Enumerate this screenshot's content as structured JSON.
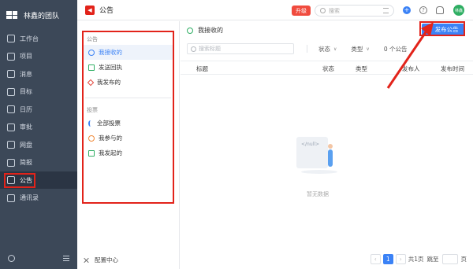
{
  "sidebar": {
    "team_name": "林鑫的团队",
    "items": [
      {
        "label": "工作台",
        "icon": "desktop-icon"
      },
      {
        "label": "项目",
        "icon": "project-icon"
      },
      {
        "label": "消息",
        "icon": "message-icon"
      },
      {
        "label": "目标",
        "icon": "target-icon"
      },
      {
        "label": "日历",
        "icon": "calendar-icon"
      },
      {
        "label": "审批",
        "icon": "approval-icon"
      },
      {
        "label": "网盘",
        "icon": "cloud-disk-icon"
      },
      {
        "label": "简报",
        "icon": "report-icon"
      },
      {
        "label": "公告",
        "icon": "announcement-icon"
      },
      {
        "label": "通讯录",
        "icon": "contacts-icon"
      }
    ]
  },
  "topbar": {
    "title": "公告",
    "upgrade_label": "升级",
    "search_placeholder": "搜索",
    "avatar_text": "林鑫"
  },
  "announce_menu": {
    "group1_title": "公告",
    "group1_items": [
      "我接收的",
      "发送回执",
      "我发布的"
    ],
    "group2_title": "投票",
    "group2_items": [
      "全部投票",
      "我参与的",
      "我发起的"
    ],
    "config_label": "配置中心"
  },
  "main": {
    "breadcrumb": "我接收的",
    "publish_label": "发布公告",
    "search_placeholder": "搜索标题",
    "status_filter": "状态",
    "type_filter": "类型",
    "count_text": "0 个公告",
    "columns": [
      "标题",
      "状态",
      "类型",
      "发布人",
      "发布时间"
    ],
    "empty_code": "</null>",
    "empty_text": "暂无数据"
  },
  "pager": {
    "current_page": "1",
    "total_text": "共1页",
    "jump_label": "跳至",
    "page_suffix": "页"
  },
  "colors": {
    "sidebar_bg": "#3c4858",
    "accent": "#3b82f6",
    "annotation_red": "#e2231a"
  }
}
